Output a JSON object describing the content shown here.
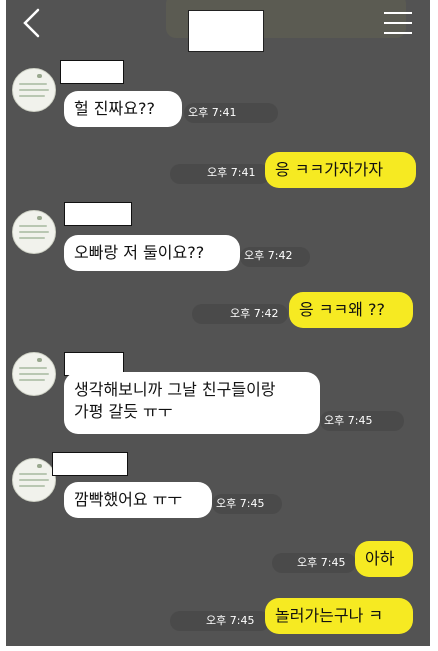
{
  "header": {
    "back_icon": "chevron-left-icon",
    "menu_icon": "hamburger-menu-icon"
  },
  "messages": [
    {
      "side": "in",
      "text": "헐 진짜요??",
      "time": "오후 7:41"
    },
    {
      "side": "out",
      "text": "응 ㅋㅋ가자가자",
      "time": "오후 7:41"
    },
    {
      "side": "in",
      "text": "오빠랑 저 둘이요??",
      "time": "오후 7:42"
    },
    {
      "side": "out",
      "text": "응 ㅋㅋ왜 ??",
      "time": "오후 7:42"
    },
    {
      "side": "in",
      "text": "생각해보니까 그날 친구들이랑\n가평 갈듯 ㅠㅜ",
      "time": "오후 7:45"
    },
    {
      "side": "in",
      "text": "깜빡했어요 ㅠㅜ",
      "time": "오후 7:45"
    },
    {
      "side": "out",
      "text": "아하",
      "time": "오후 7:45"
    },
    {
      "side": "out",
      "text": "놀러가는구나 ㅋ",
      "time": "오후 7:45"
    }
  ],
  "colors": {
    "background": "#535353",
    "incoming_bubble": "#ffffff",
    "outgoing_bubble": "#f6ea22"
  }
}
